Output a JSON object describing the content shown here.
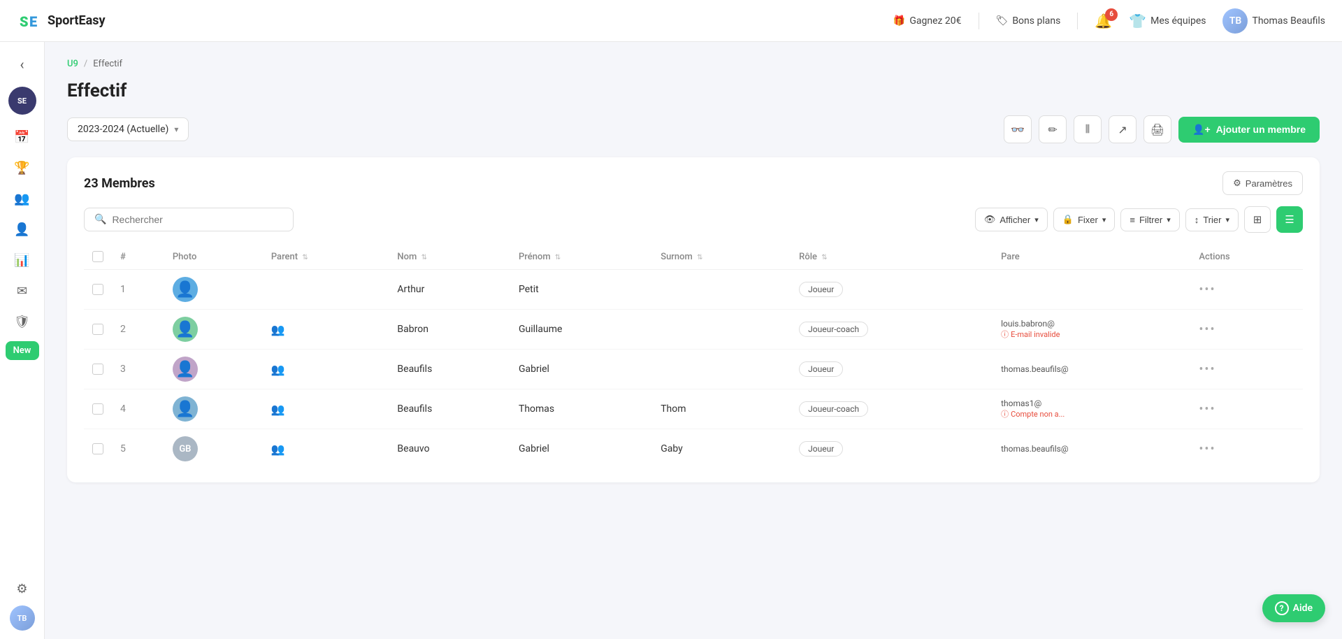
{
  "topnav": {
    "logo_abbr": "SE",
    "logo_name": "SportEasy",
    "earn_label": "Gagnez 20€",
    "deals_label": "Bons plans",
    "notifications_count": "6",
    "teams_label": "Mes équipes",
    "user_name": "Thomas Beaufils",
    "user_initials": "TB"
  },
  "sidebar": {
    "back_icon": "‹",
    "logo_text": "SE",
    "new_label": "New",
    "settings_icon": "⚙",
    "user_initials": "TB"
  },
  "breadcrumb": {
    "team": "U9",
    "separator": "/",
    "current": "Effectif"
  },
  "page": {
    "title": "Effectif",
    "season": "2023-2024 (Actuelle)",
    "add_member": "Ajouter un membre",
    "members_count": "23 Membres",
    "params_label": "Paramètres",
    "search_placeholder": "Rechercher",
    "afficher_label": "Afficher",
    "fixer_label": "Fixer",
    "filtrer_label": "Filtrer",
    "trier_label": "Trier"
  },
  "table": {
    "headers": [
      "#",
      "Photo",
      "Parent",
      "Nom",
      "Prénom",
      "Surnom",
      "Rôle",
      "Pare",
      "Actions"
    ],
    "rows": [
      {
        "num": "1",
        "initials": "",
        "has_photo": true,
        "avatar_color": "#5dade2",
        "has_parent": false,
        "nom": "Arthur",
        "prenom": "Petit",
        "surnom": "",
        "role": "Joueur",
        "email": "",
        "email_warning": "",
        "account_warning": ""
      },
      {
        "num": "2",
        "initials": "",
        "has_photo": true,
        "avatar_color": "#7dcea0",
        "has_parent": true,
        "nom": "Babron",
        "prenom": "Guillaume",
        "surnom": "",
        "role": "Joueur-coach",
        "email": "louis.babron@",
        "email_warning": "E-mail invalide",
        "account_warning": ""
      },
      {
        "num": "3",
        "initials": "",
        "has_photo": true,
        "avatar_color": "#a9cce3",
        "has_parent": true,
        "nom": "Beaufils",
        "prenom": "Gabriel",
        "surnom": "",
        "role": "Joueur",
        "email": "thomas.beaufils@",
        "email_warning": "",
        "account_warning": ""
      },
      {
        "num": "4",
        "initials": "",
        "has_photo": true,
        "avatar_color": "#7fb3d3",
        "has_parent": true,
        "nom": "Beaufils",
        "prenom": "Thomas",
        "surnom": "Thom",
        "role": "Joueur-coach",
        "email": "thomas1@",
        "email_warning": "",
        "account_warning": "Compte non a..."
      },
      {
        "num": "5",
        "initials": "GB",
        "has_photo": false,
        "avatar_color": "#85c1e9",
        "has_parent": true,
        "nom": "Beauvo",
        "prenom": "Gabriel",
        "surnom": "Gaby",
        "role": "Joueur",
        "email": "thomas.beaufils@",
        "email_warning": "",
        "account_warning": ""
      }
    ]
  },
  "icons": {
    "search": "🔍",
    "chevron_down": "▾",
    "eye": "👁",
    "lock": "🔒",
    "filter": "⚡",
    "sort": "↕",
    "grid": "⊞",
    "list": "☰",
    "share": "↗",
    "print": "🖨",
    "edit": "✏",
    "glasses": "👓",
    "columns": "⫼",
    "gear": "⚙",
    "plus_user": "👤",
    "parent": "👥",
    "more": "•••",
    "warning": "ⓘ"
  }
}
